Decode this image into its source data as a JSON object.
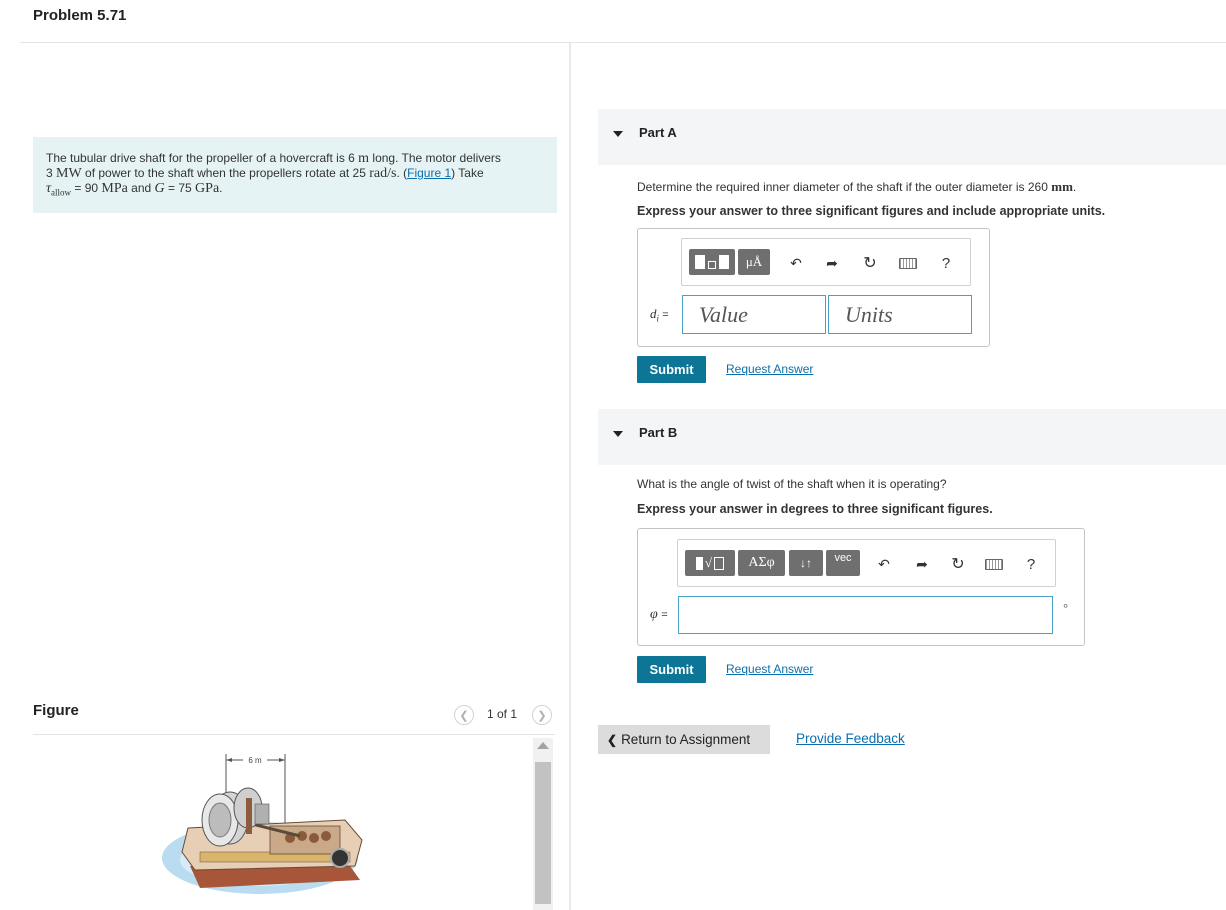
{
  "problem": {
    "title": "Problem 5.71",
    "text_1": "The tubular drive shaft for the propeller of a hovercraft is 6",
    "unit_m": "m",
    "text_2": " long. The motor delivers",
    "value_3": "3",
    "unit_MW": "MW",
    "text_3": " of power to the shaft when the propellers rotate at 25",
    "unit_rads": "rad/s",
    "text_4": ". (",
    "figure_link": "Figure 1",
    "text_5": ") Take",
    "tau_sym": "τ",
    "tau_sub": "allow",
    "text_6": " = 90",
    "unit_MPa": "MPa",
    "text_7": " and",
    "g_sym": "G",
    "text_8": " = 75",
    "unit_GPa": "GPa",
    "text_9": "."
  },
  "figure": {
    "title": "Figure",
    "pager": "1 of 1",
    "dimension_label": "6 m"
  },
  "partA": {
    "label": "Part A",
    "question_prefix": "Determine the required inner diameter of the shaft if the outer diameter is 260",
    "question_unit": "mm",
    "question_suffix": ".",
    "instruction": "Express your answer to three significant figures and include appropriate units.",
    "var_symbol": "d",
    "var_sub": "i",
    "equals": "=",
    "value_placeholder": "Value",
    "units_placeholder": "Units",
    "toolbar_mu": "μÅ",
    "help": "?",
    "submit": "Submit",
    "request": "Request Answer"
  },
  "partB": {
    "label": "Part B",
    "question": "What is the angle of twist of the shaft when it is operating?",
    "instruction": "Express your answer in degrees to three significant figures.",
    "var_symbol": "φ",
    "equals": "=",
    "toolbar_greek": "ΑΣφ",
    "toolbar_arrows": "↓↑",
    "toolbar_vec": "vec",
    "help": "?",
    "degree_unit": "°",
    "submit": "Submit",
    "request": "Request Answer"
  },
  "footer": {
    "return": "Return to Assignment",
    "feedback": "Provide Feedback"
  }
}
